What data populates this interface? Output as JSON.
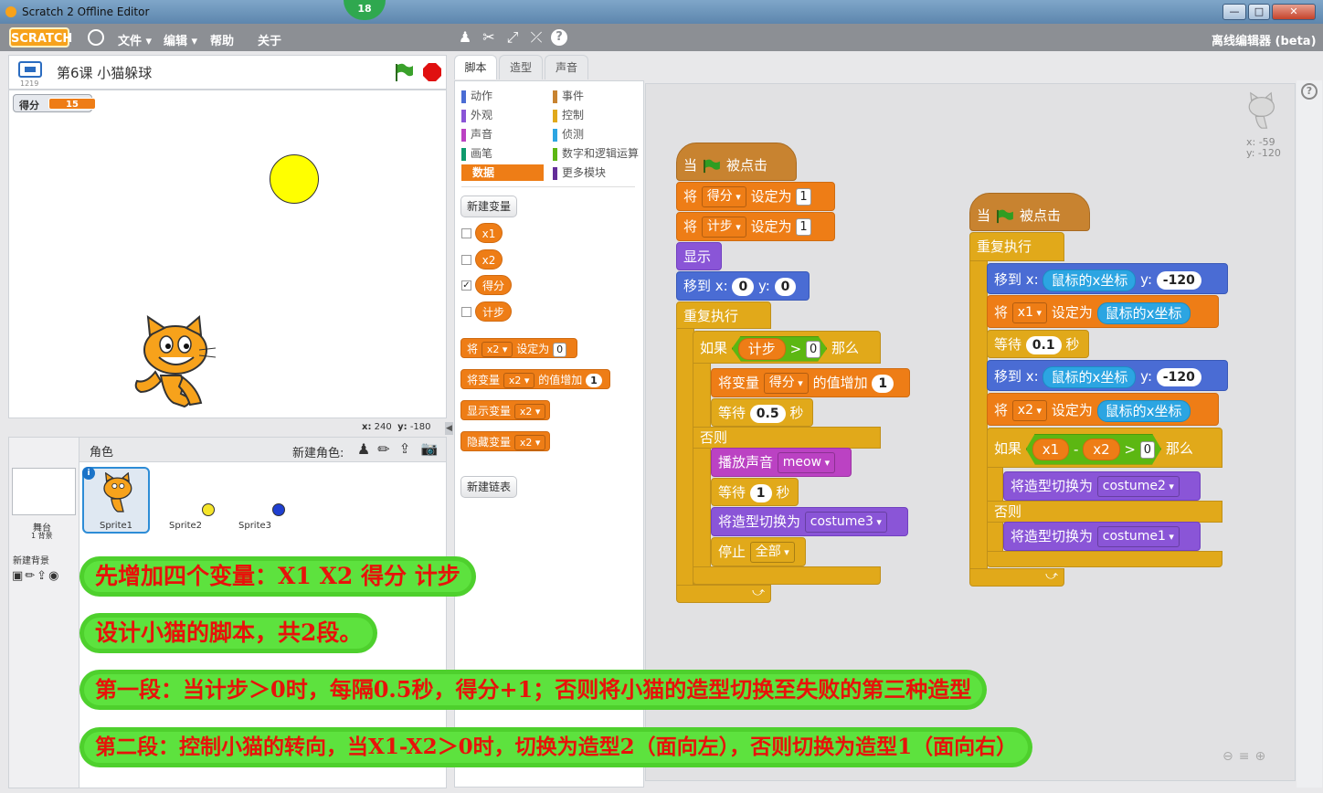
{
  "window": {
    "title": "Scratch 2 Offline Editor",
    "badge": "18",
    "minimize": "—",
    "restore": "□",
    "close": "✕"
  },
  "menubar": {
    "logo": "SCRATCH",
    "items": [
      "文件",
      "编辑",
      "帮助",
      "关于"
    ],
    "right_label": "离线编辑器 (beta)",
    "tool_icons": [
      "duplicate-icon",
      "cut-icon",
      "grow-icon",
      "shrink-icon",
      "help-icon"
    ]
  },
  "stage": {
    "project_title": "第6课  小猫躲球",
    "version": "1219",
    "monitor": {
      "label": "得分",
      "value": "15"
    },
    "coords": {
      "x_label": "x:",
      "x": "240",
      "y_label": "y:",
      "y": "-180"
    }
  },
  "sprites": {
    "header": "角色",
    "new_sprite_label": "新建角色:",
    "stage_label": "舞台",
    "stage_sub": "1 背景",
    "new_backdrop": "新建背景",
    "list": [
      {
        "name": "Sprite1"
      },
      {
        "name": "Sprite2"
      },
      {
        "name": "Sprite3"
      }
    ],
    "colors": {
      "sprite2": "#f5e52a",
      "sprite3": "#1f3fd0"
    }
  },
  "tabs": [
    "脚本",
    "造型",
    "声音"
  ],
  "palette": {
    "categories_left": [
      {
        "label": "动作",
        "color": "#4a6cd4"
      },
      {
        "label": "外观",
        "color": "#8a55d7"
      },
      {
        "label": "声音",
        "color": "#bb42c3"
      },
      {
        "label": "画笔",
        "color": "#0e9a6c"
      },
      {
        "label": "数据",
        "color": "#ee7d16"
      }
    ],
    "categories_right": [
      {
        "label": "事件",
        "color": "#c88330"
      },
      {
        "label": "控制",
        "color": "#e1a91a"
      },
      {
        "label": "侦测",
        "color": "#2ca5e2"
      },
      {
        "label": "数字和逻辑运算",
        "color": "#5cb712"
      },
      {
        "label": "更多模块",
        "color": "#632d99"
      }
    ],
    "new_variable": "新建变量",
    "variables": [
      {
        "name": "x1",
        "checked": false
      },
      {
        "name": "x2",
        "checked": false
      },
      {
        "name": "得分",
        "checked": true
      },
      {
        "name": "计步",
        "checked": false
      }
    ],
    "blocks": {
      "set_prefix": "将",
      "set_var": "x2",
      "set_mid": "设定为",
      "set_val": "0",
      "change_prefix": "将变量",
      "change_var": "x2",
      "change_mid": "的值增加",
      "change_val": "1",
      "show_label": "显示变量",
      "show_var": "x2",
      "hide_label": "隐藏变量",
      "hide_var": "x2"
    },
    "new_list": "新建链表"
  },
  "script1": {
    "hat_when": "当",
    "hat_clicked": "被点击",
    "set1_a": "将",
    "set1_var": "得分",
    "set1_b": "设定为",
    "set1_val": "1",
    "set2_a": "将",
    "set2_var": "计步",
    "set2_b": "设定为",
    "set2_val": "1",
    "show": "显示",
    "goto_a": "移到 x:",
    "goto_x": "0",
    "goto_b": "y:",
    "goto_y": "0",
    "forever": "重复执行",
    "if": "如果",
    "cond_var": "计步",
    "cond_op": ">",
    "cond_val": "0",
    "then": "那么",
    "change_a": "将变量",
    "change_var": "得分",
    "change_b": "的值增加",
    "change_val": "1",
    "wait_a": "等待",
    "wait_val": "0.5",
    "wait_b": "秒",
    "else": "否则",
    "play_a": "播放声音",
    "play_sound": "meow",
    "wait2_a": "等待",
    "wait2_val": "1",
    "wait2_b": "秒",
    "switch_a": "将造型切换为",
    "switch_costume": "costume3",
    "stop_a": "停止",
    "stop_opt": "全部"
  },
  "script2": {
    "hat_when": "当",
    "hat_clicked": "被点击",
    "forever": "重复执行",
    "goto1_a": "移到 x:",
    "goto1_rep": "鼠标的x坐标",
    "goto1_b": "y:",
    "goto1_y": "-120",
    "set1_a": "将",
    "set1_var": "x1",
    "set1_b": "设定为",
    "set1_rep": "鼠标的x坐标",
    "wait_a": "等待",
    "wait_val": "0.1",
    "wait_b": "秒",
    "goto2_a": "移到 x:",
    "goto2_rep": "鼠标的x坐标",
    "goto2_b": "y:",
    "goto2_y": "-120",
    "set2_a": "将",
    "set2_var": "x2",
    "set2_b": "设定为",
    "set2_rep": "鼠标的x坐标",
    "if": "如果",
    "op_l": "x1",
    "op_minus": "-",
    "op_r": "x2",
    "gt": ">",
    "gt_val": "0",
    "then": "那么",
    "switch1_a": "将造型切换为",
    "switch1_costume": "costume2",
    "else": "否则",
    "switch2_a": "将造型切换为",
    "switch2_costume": "costume1"
  },
  "sprite_info": {
    "x": "x: -59",
    "y": "y: -120"
  },
  "notes": [
    "先增加四个变量：X1  X2  得分  计步",
    "设计小猫的脚本，共2段。",
    "第一段：当计步＞0时，每隔0.5秒，得分+1；否则将小猫的造型切换至失败的第三种造型",
    "第二段：控制小猫的转向，当X1-X2＞0时，切换为造型2（面向左），否则切换为造型1（面向右）"
  ]
}
